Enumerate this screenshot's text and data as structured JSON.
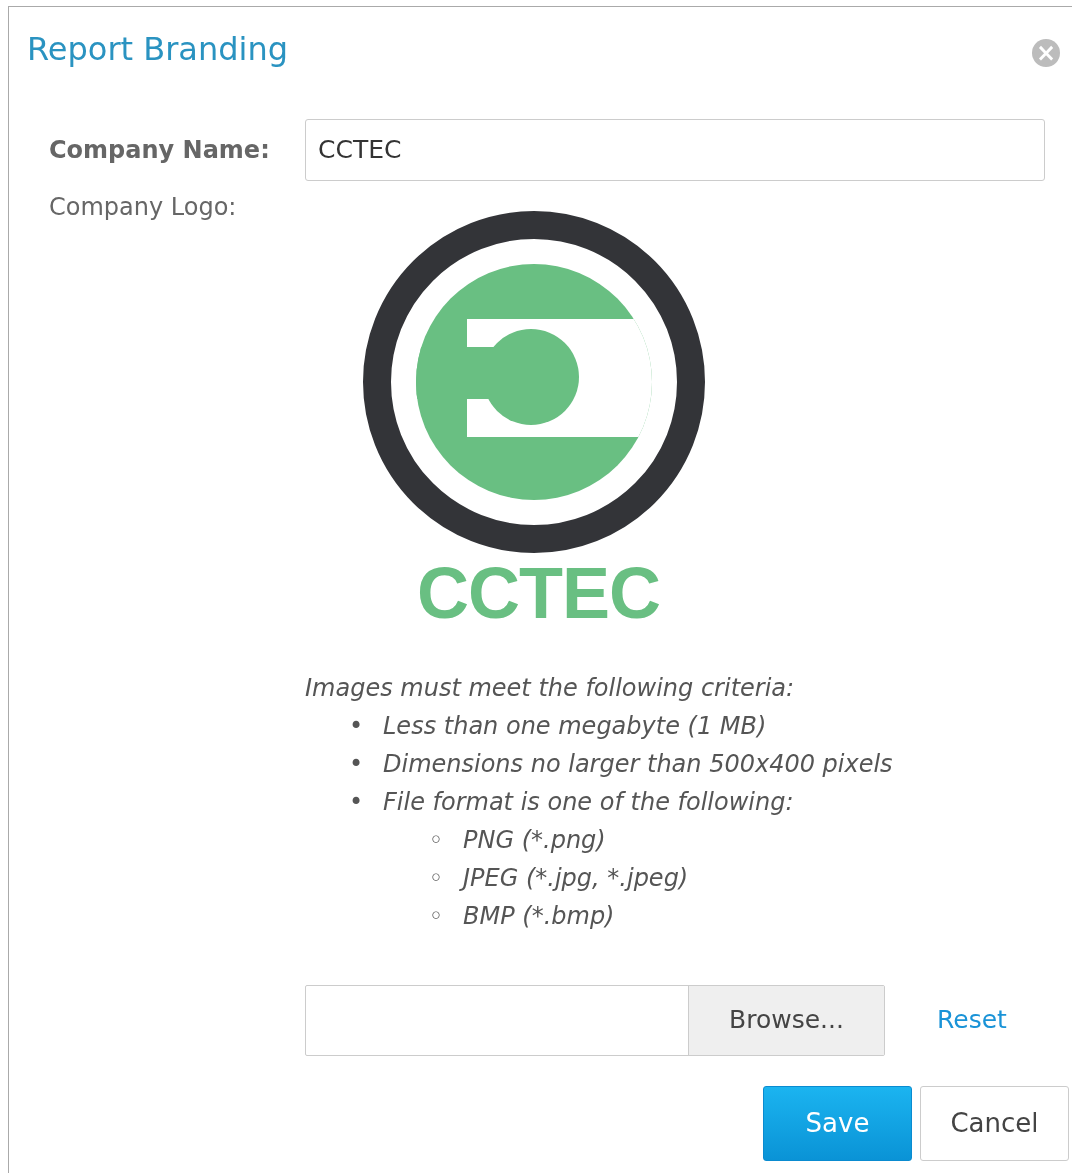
{
  "dialog": {
    "title": "Report Branding",
    "close_glyph": "×"
  },
  "form": {
    "company_name_label": "Company Name:",
    "company_name_value": "CCTEC",
    "company_logo_label": "Company Logo:"
  },
  "logo": {
    "text": "CCTEC"
  },
  "criteria": {
    "intro": "Images must meet the following criteria:",
    "items": [
      {
        "marker": "•",
        "text": "Less than one megabyte (1 MB)"
      },
      {
        "marker": "•",
        "text": "Dimensions no larger than 500x400 pixels"
      },
      {
        "marker": "•",
        "text": "File format is one of the following:",
        "children": [
          {
            "marker": "◦",
            "text": "PNG (*.png)"
          },
          {
            "marker": "◦",
            "text": "JPEG (*.jpg, *.jpeg)"
          },
          {
            "marker": "◦",
            "text": "BMP (*.bmp)"
          }
        ]
      }
    ]
  },
  "file": {
    "browse_label": "Browse...",
    "reset_label": "Reset"
  },
  "buttons": [
    {
      "label": "Save",
      "kind": "primary"
    },
    {
      "label": "Cancel",
      "kind": "secondary"
    }
  ]
}
